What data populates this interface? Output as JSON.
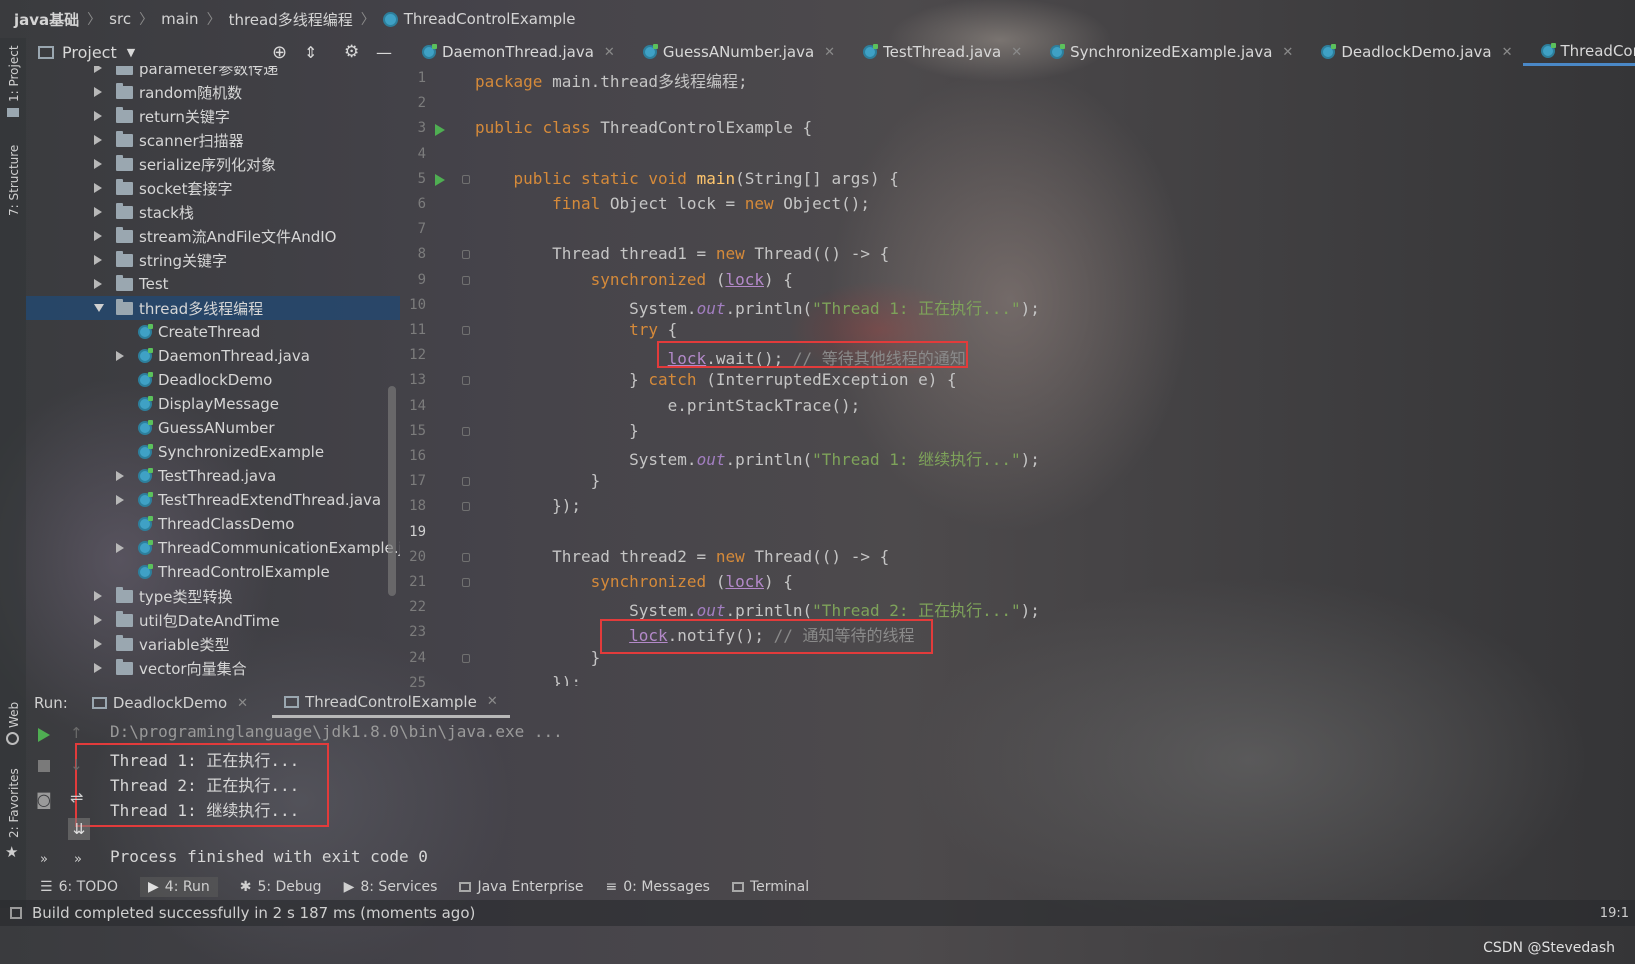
{
  "breadcrumb": {
    "project": "java基础",
    "src": "src",
    "main": "main",
    "package": "thread多线程编程",
    "file": "ThreadControlExample"
  },
  "left_strip": {
    "project": "1: Project",
    "structure": "7: Structure",
    "web": "Web",
    "favorites": "2: Favorites"
  },
  "project_panel": {
    "title": "Project",
    "tree": [
      {
        "label": "parameter参数传递",
        "type": "folder",
        "expanded": false
      },
      {
        "label": "random随机数",
        "type": "folder",
        "expanded": false
      },
      {
        "label": "return关键字",
        "type": "folder",
        "expanded": false
      },
      {
        "label": "scanner扫描器",
        "type": "folder",
        "expanded": false
      },
      {
        "label": "serialize序列化对象",
        "type": "folder",
        "expanded": false
      },
      {
        "label": "socket套接字",
        "type": "folder",
        "expanded": false
      },
      {
        "label": "stack栈",
        "type": "folder",
        "expanded": false
      },
      {
        "label": "stream流AndFile文件AndIO",
        "type": "folder",
        "expanded": false
      },
      {
        "label": "string关键字",
        "type": "folder",
        "expanded": false
      },
      {
        "label": "Test",
        "type": "folder",
        "expanded": false
      },
      {
        "label": "thread多线程编程",
        "type": "folder",
        "expanded": true
      },
      {
        "label": "CreateThread",
        "type": "class"
      },
      {
        "label": "DaemonThread.java",
        "type": "file"
      },
      {
        "label": "DeadlockDemo",
        "type": "class"
      },
      {
        "label": "DisplayMessage",
        "type": "class"
      },
      {
        "label": "GuessANumber",
        "type": "class"
      },
      {
        "label": "SynchronizedExample",
        "type": "class"
      },
      {
        "label": "TestThread.java",
        "type": "file"
      },
      {
        "label": "TestThreadExtendThread.java",
        "type": "file"
      },
      {
        "label": "ThreadClassDemo",
        "type": "class"
      },
      {
        "label": "ThreadCommunicationExample.java",
        "type": "file"
      },
      {
        "label": "ThreadControlExample",
        "type": "class"
      },
      {
        "label": "type类型转换",
        "type": "folder",
        "expanded": false
      },
      {
        "label": "util包DateAndTime",
        "type": "folder",
        "expanded": false
      },
      {
        "label": "variable类型",
        "type": "folder",
        "expanded": false
      },
      {
        "label": "vector向量集合",
        "type": "folder",
        "expanded": false
      }
    ]
  },
  "editor_tabs": [
    {
      "label": "DaemonThread.java",
      "active": false
    },
    {
      "label": "GuessANumber.java",
      "active": false
    },
    {
      "label": "TestThread.java",
      "active": false
    },
    {
      "label": "SynchronizedExample.java",
      "active": false
    },
    {
      "label": "DeadlockDemo.java",
      "active": false
    },
    {
      "label": "ThreadControlExample",
      "active": true
    }
  ],
  "code_lines": [
    "package main.thread多线程编程;",
    "",
    "public class ThreadControlExample {",
    "",
    "    public static void main(String[] args) {",
    "        final Object lock = new Object();",
    "",
    "        Thread thread1 = new Thread(() -> {",
    "            synchronized (lock) {",
    "                System.out.println(\"Thread 1: 正在执行...\");",
    "                try {",
    "                    lock.wait(); // 等待其他线程的通知",
    "                } catch (InterruptedException e) {",
    "                    e.printStackTrace();",
    "                }",
    "                System.out.println(\"Thread 1: 继续执行...\");",
    "            }",
    "        });",
    "",
    "        Thread thread2 = new Thread(() -> {",
    "            synchronized (lock) {",
    "                System.out.println(\"Thread 2: 正在执行...\");",
    "                lock.notify(); // 通知等待的线程",
    "            }",
    "        });"
  ],
  "line_numbers": [
    "1",
    "2",
    "3",
    "4",
    "5",
    "6",
    "7",
    "8",
    "9",
    "10",
    "11",
    "12",
    "13",
    "14",
    "15",
    "16",
    "17",
    "18",
    "19",
    "20",
    "21",
    "22",
    "23",
    "24",
    "25"
  ],
  "run_panel": {
    "label": "Run:",
    "tabs": [
      {
        "label": "DeadlockDemo",
        "active": false
      },
      {
        "label": "ThreadControlExample",
        "active": true
      }
    ],
    "console": [
      "D:\\programinglanguage\\jdk1.8.0\\bin\\java.exe ...",
      "Thread 1: 正在执行...",
      "Thread 2: 正在执行...",
      "Thread 1: 继续执行...",
      "",
      "Process finished with exit code 0"
    ]
  },
  "bottom_tools": [
    {
      "label": "6: TODO"
    },
    {
      "label": "4: Run"
    },
    {
      "label": "5: Debug"
    },
    {
      "label": "8: Services"
    },
    {
      "label": "Java Enterprise"
    },
    {
      "label": "0: Messages"
    },
    {
      "label": "Terminal"
    }
  ],
  "status_text": "Build completed successfully in 2 s 187 ms (moments ago)",
  "watermark": "CSDN @Stevedash",
  "caret_pos": "19:1"
}
